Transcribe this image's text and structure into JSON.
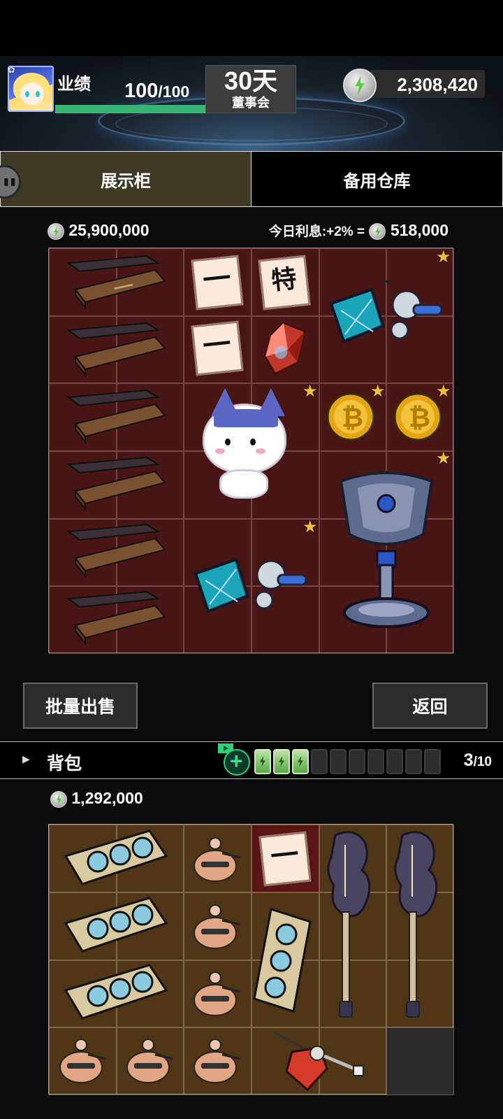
{
  "header": {
    "performance_label": "业绩",
    "performance_value": "100",
    "performance_max": "/100",
    "performance_progress": 1.0,
    "days_value": "30天",
    "days_label": "董事会",
    "balance": "2,308,420"
  },
  "tabs": {
    "display": "展示柜",
    "storage": "备用仓库"
  },
  "display": {
    "total": "25,900,000",
    "interest_label": "今日利息:+2% =",
    "interest_value": "518,000",
    "ticket_glyph_1": "一",
    "ticket_glyph_2": "特",
    "ticket_glyph_3": "一"
  },
  "buttons": {
    "sell": "批量出售",
    "back": "返回"
  },
  "bag": {
    "title": "背包",
    "count": "3",
    "capacity": "/10",
    "total": "1,292,000",
    "ticket_glyph": "一"
  },
  "colors": {
    "display_bg": "#4a1515",
    "bag_bg": "#4f3617",
    "star": "#f1c232",
    "energy_green": "#37b673"
  }
}
